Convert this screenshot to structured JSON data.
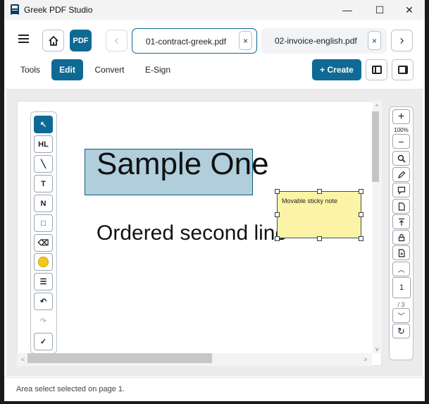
{
  "window": {
    "title": "Greek PDF Studio",
    "controls": {
      "minimize": "—",
      "maximize": "☐",
      "close": "✕"
    }
  },
  "toolbar": {
    "pdf_label": "PDF",
    "back_arrow": "‹",
    "forward_arrow": "›",
    "tabs": [
      {
        "label": "01-contract-greek.pdf",
        "close": "×",
        "active": true
      },
      {
        "label": "02-invoice-english.pdf",
        "close": "×",
        "active": false
      }
    ]
  },
  "modes": {
    "items": [
      {
        "label": "Tools",
        "active": false
      },
      {
        "label": "Edit",
        "active": true
      },
      {
        "label": "Convert",
        "active": false
      },
      {
        "label": "E-Sign",
        "active": false
      }
    ],
    "create_label": "+ Create"
  },
  "tools": {
    "select": "↖",
    "highlight": "HL",
    "pen": "╲",
    "text": "T",
    "note": "N",
    "rectangle": "□",
    "eraser": "⌫",
    "lines": "☰",
    "undo": "↶",
    "redo": "↷",
    "confirm": "✓"
  },
  "sidebar": {
    "zoom_in": "+",
    "zoom_level": "100%",
    "zoom_out": "−",
    "page_up": "︿",
    "page_down": "﹀",
    "current_page": "1",
    "page_total": "/ 3",
    "refresh": "↻"
  },
  "document": {
    "line1": "Sample One",
    "line2": "Ordered second line",
    "sticky_note": "Movable sticky note"
  },
  "scroll": {
    "up": "^",
    "down": "v",
    "left": "<",
    "right": ">"
  },
  "status": {
    "text": "Area select selected on page 1."
  },
  "colors": {
    "accent": "#0e6a94",
    "highlight": "#acd0e1",
    "sticky": "#fbf4a6",
    "pen_color": "#f5c518"
  }
}
